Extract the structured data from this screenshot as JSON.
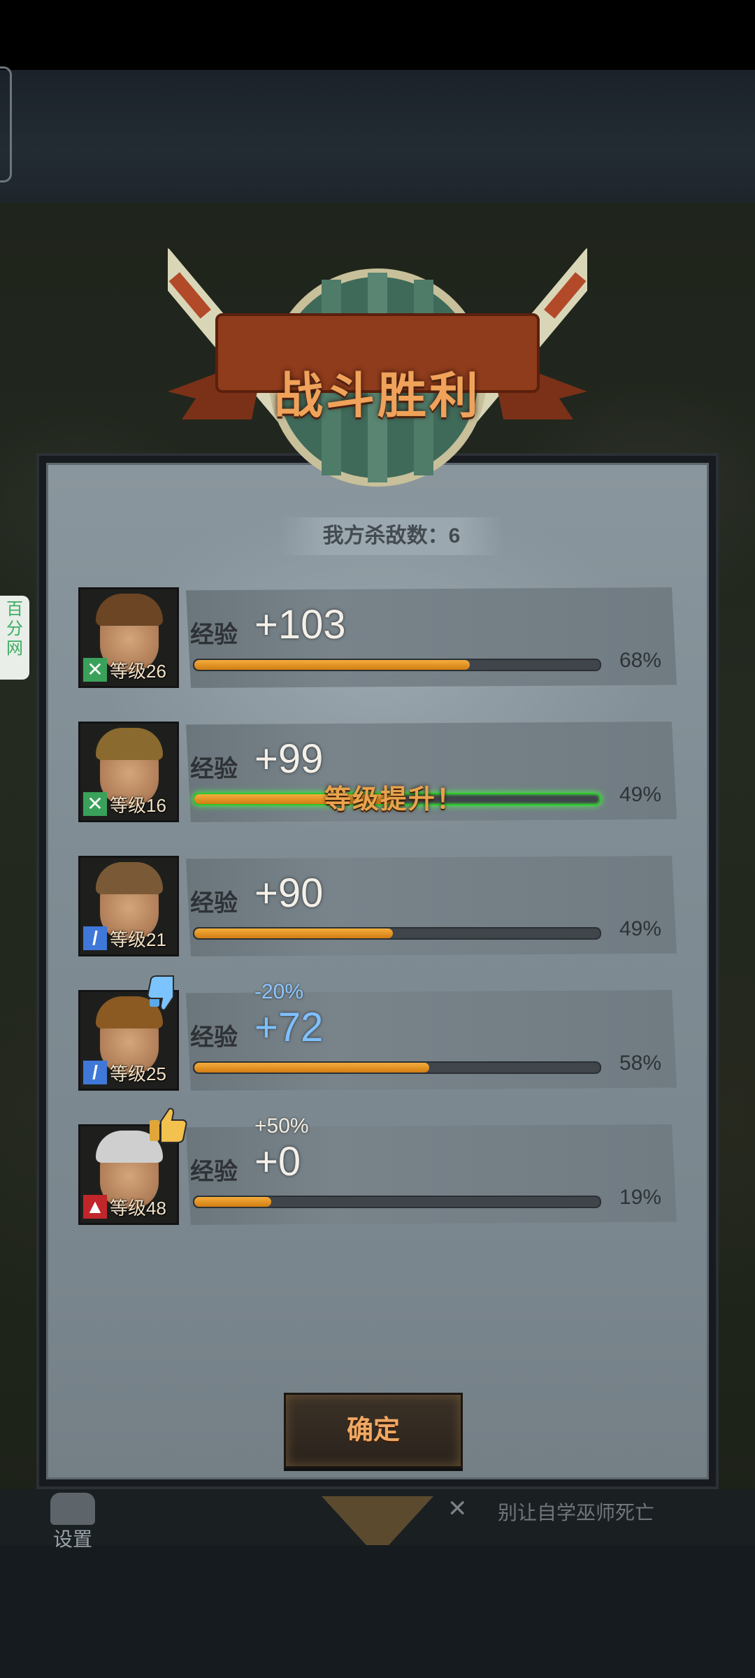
{
  "title": "战斗胜利",
  "kill_count": "我方杀敌数：6",
  "exp_label": "经验",
  "level_up_text": "等级提升！",
  "confirm_label": "确定",
  "side_tag": "百分网",
  "bottom": {
    "settings_label": "设置",
    "tip": "别让自学巫师死亡"
  },
  "colors": {
    "exp_fill": "#e39125",
    "level_up_glow": "#46ff46",
    "title": "#f0a25a",
    "penalty_blue": "#7ec0ff"
  },
  "heroes": [
    {
      "level": "等级26",
      "exp": "+103",
      "bonus": "",
      "progress": 0.68,
      "progress_text": "68%",
      "role_icon": "shield-cross-icon",
      "leveled_up": false
    },
    {
      "level": "等级16",
      "exp": "+99",
      "bonus": "",
      "progress": 0.49,
      "progress_text": "49%",
      "role_icon": "shield-cross-icon",
      "leveled_up": true
    },
    {
      "level": "等级21",
      "exp": "+90",
      "bonus": "",
      "progress": 0.49,
      "progress_text": "49%",
      "role_icon": "sword-icon",
      "leveled_up": false
    },
    {
      "level": "等级25",
      "exp": "+72",
      "bonus": "-20%",
      "progress": 0.58,
      "progress_text": "58%",
      "role_icon": "sword-icon",
      "leveled_up": false,
      "modifier_icon": "thumbs-down-icon"
    },
    {
      "level": "等级48",
      "exp": "+0",
      "bonus": "+50%",
      "progress": 0.19,
      "progress_text": "19%",
      "role_icon": "wolf-icon",
      "leveled_up": false,
      "modifier_icon": "thumbs-up-icon"
    }
  ]
}
